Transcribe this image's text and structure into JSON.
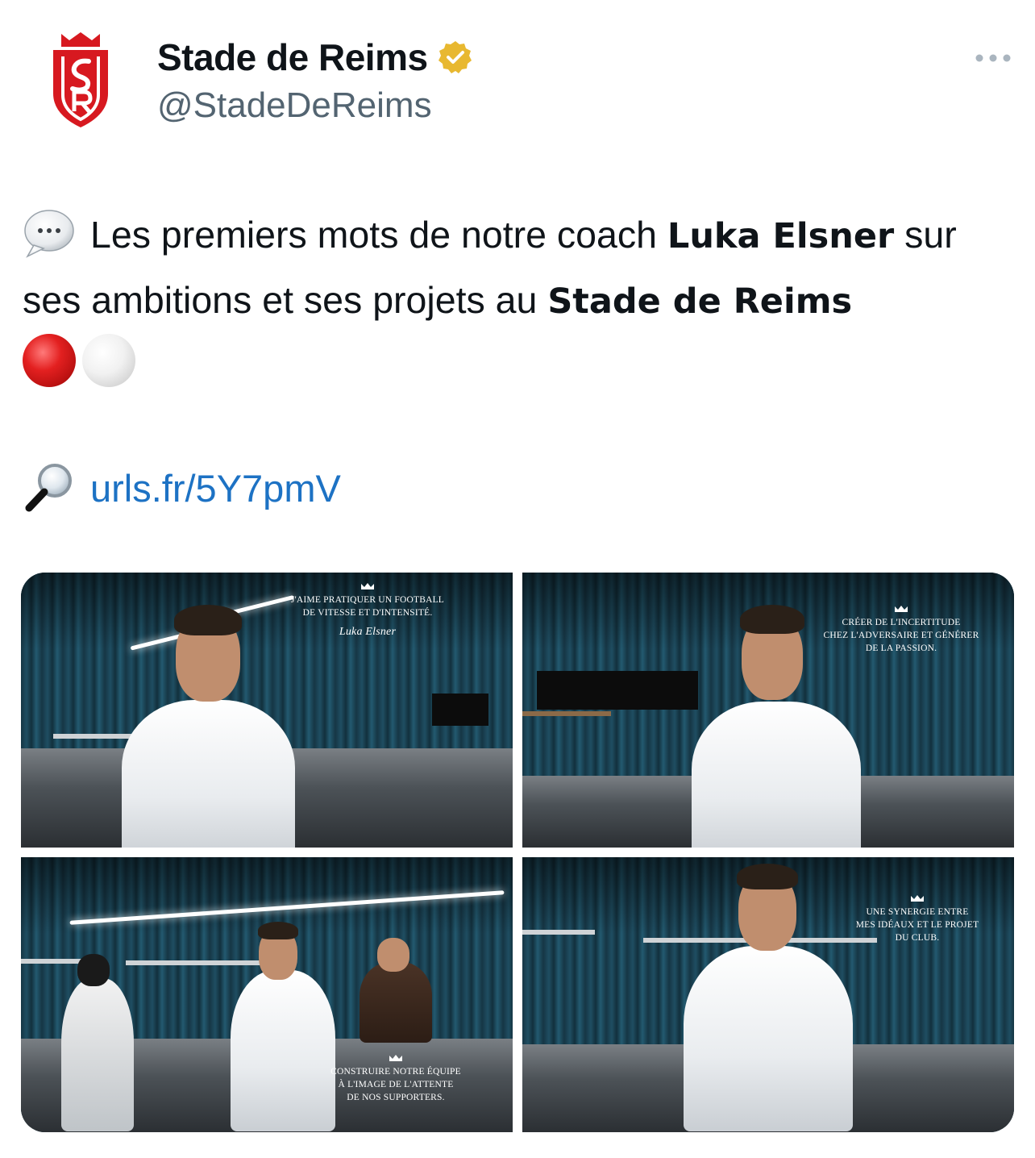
{
  "account": {
    "display_name": "Stade de Reims",
    "handle": "@StadeDeReims"
  },
  "tweet": {
    "text_part1": "Les premiers mots de notre coach ",
    "bold1": "Luka Elsner",
    "text_part2": " sur ses ambitions et ses projets au ",
    "bold2": "Stade de Reims",
    "link": "urls.fr/5Y7pmV"
  },
  "icons": {
    "avatar": "stade-de-reims-crest",
    "verified": "verified-badge-gold",
    "more": "more-dots-icon",
    "speech": "speech-bubble-emoji",
    "magnifier": "magnifying-glass-emoji",
    "circles": [
      "red-circle-emoji",
      "white-circle-emoji"
    ]
  },
  "colors": {
    "brand_red": "#d71920",
    "link_blue": "#1d72c4",
    "secondary_text": "#536471",
    "verified_gold": "#e8b830"
  },
  "media": [
    {
      "caption_lines": [
        "J'AIME PRATIQUER UN FOOTBALL",
        "DE VITESSE ET D'INTENSITÉ."
      ],
      "signature": "Luka Elsner"
    },
    {
      "caption_lines": [
        "CRÉER DE L'INCERTITUDE",
        "CHEZ L'ADVERSAIRE ET GÉNÉRER",
        "DE LA PASSION."
      ]
    },
    {
      "caption_lines": [
        "CONSTRUIRE NOTRE ÉQUIPE",
        "À L'IMAGE DE L'ATTENTE",
        "DE NOS SUPPORTERS."
      ]
    },
    {
      "caption_lines": [
        "UNE SYNERGIE ENTRE",
        "MES IDÉAUX ET LE PROJET",
        "DU CLUB."
      ]
    }
  ]
}
